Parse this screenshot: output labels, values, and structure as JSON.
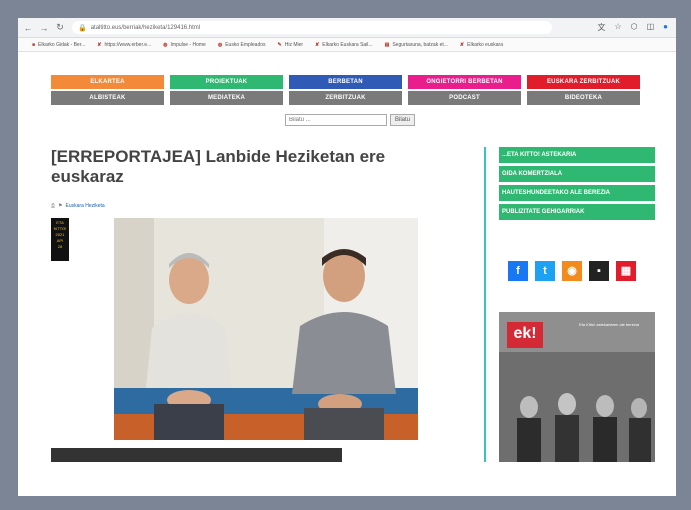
{
  "browser": {
    "url": "ataltitto.eus/berriak/heziketa/129416.html",
    "bookmarks": [
      "Elkarko Gidak - Ber...",
      "https://www.erber.e...",
      "Impulse - Home",
      "Eusko Empleados",
      "Hiz Mier",
      "Elkarko Euskara Sail...",
      "Segurtasuna, batzak et...",
      "Elkarko euskara"
    ]
  },
  "nav": {
    "top": [
      {
        "label": "ELKARTEA",
        "color": "#f28a3a"
      },
      {
        "label": "PROIEKTUAK",
        "color": "#2eb872"
      },
      {
        "label": "BERBETAN",
        "color": "#2f5bb7"
      },
      {
        "label": "ONGIETORRI BERBETAN",
        "color": "#e91e8c"
      },
      {
        "label": "EUSKARA ZERBITZUAK",
        "color": "#e21d2b"
      }
    ],
    "bottom": [
      "ALBISTEAK",
      "MEDIATEKA",
      "ZERBITZUAK",
      "PODCAST",
      "BIDEOTEKA"
    ]
  },
  "search": {
    "placeholder": "Bilatu ...",
    "button": "Bilatu"
  },
  "article": {
    "title": "[ERREPORTAJEA] Lanbide Heziketan ere euskaraz",
    "meta_link": "Euskara Heziketa",
    "badge": [
      "ETA",
      "KITTO!",
      "2021",
      "API",
      "28"
    ]
  },
  "sidebar": {
    "links": [
      "...ETA KITTO! ASTEKARIA",
      "GIDA KOMERTZIALA",
      "HAUTESHUNDEETAKO ALE BEREZIA",
      "PUBLIZITATE GEHIGARRIAK"
    ],
    "social": [
      {
        "name": "facebook-icon",
        "glyph": "f",
        "color": "#1877f2"
      },
      {
        "name": "twitter-icon",
        "glyph": "t",
        "color": "#1da1f2"
      },
      {
        "name": "rss-icon",
        "glyph": "◉",
        "color": "#f28a1e"
      },
      {
        "name": "issuu-icon",
        "glyph": "▪",
        "color": "#222222"
      },
      {
        "name": "calendar-icon",
        "glyph": "▦",
        "color": "#e21d2b"
      }
    ],
    "ad": {
      "logo": "ek!",
      "text": "Eta Kitto! astekariaren ale berezia"
    }
  }
}
